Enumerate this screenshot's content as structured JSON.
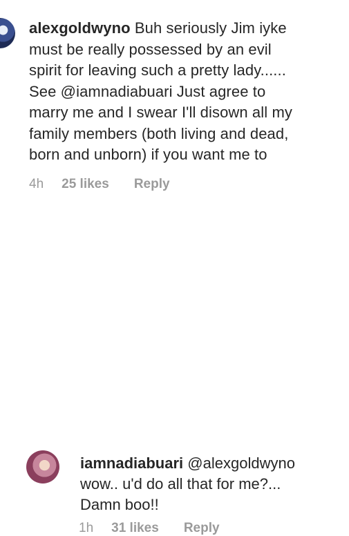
{
  "comments": [
    {
      "username": "alexgoldwyno",
      "lines": [
        "Buh seriously Jim iyke",
        "must be really possessed by an evil",
        "spirit for leaving such a pretty lady......",
        "See @iamnadiabuari Just agree to",
        "marry me and I swear I'll disown all my",
        "family members (both living and dead,",
        "born and unborn) if you want me to"
      ],
      "time": "4h",
      "likes": "25 likes",
      "reply": "Reply"
    },
    {
      "username": "iamnadiabuari",
      "lines": [
        "@alexgoldwyno",
        "wow.. u'd do all that for me?...",
        "Damn boo!!"
      ],
      "time": "1h",
      "likes": "31 likes",
      "reply": "Reply"
    }
  ]
}
